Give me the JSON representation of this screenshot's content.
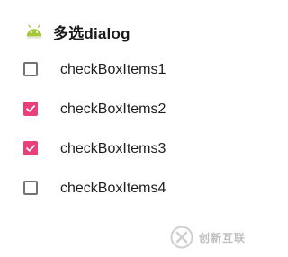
{
  "dialog": {
    "title": "多选dialog",
    "icon": "android-icon",
    "items": [
      {
        "label": "checkBoxItems1",
        "checked": false
      },
      {
        "label": "checkBoxItems2",
        "checked": true
      },
      {
        "label": "checkBoxItems3",
        "checked": true
      },
      {
        "label": "checkBoxItems4",
        "checked": false
      }
    ]
  },
  "watermark": {
    "text": "创新互联",
    "icon": "chuangxin-logo-icon"
  },
  "colors": {
    "accent": "#e8407a",
    "android_green": "#a4c639",
    "unchecked_border": "#737373"
  }
}
